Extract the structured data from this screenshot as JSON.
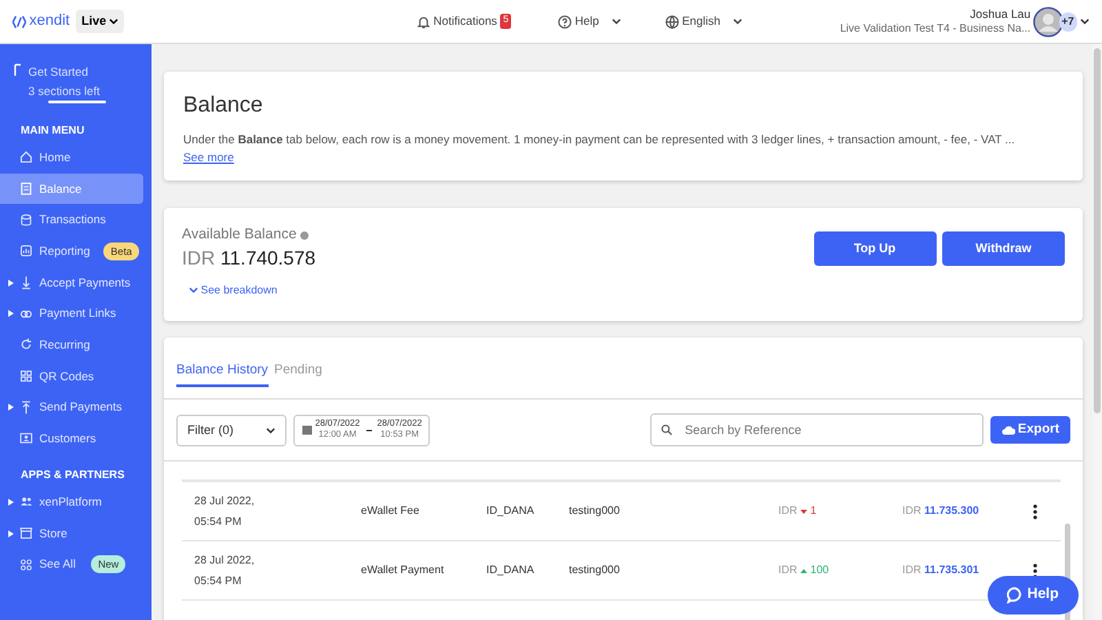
{
  "topbar": {
    "logo": "xendit",
    "mode": "Live",
    "notifications": {
      "label": "Notifications",
      "count": "5"
    },
    "help": "Help",
    "language": "English",
    "user": {
      "name": "Joshua Lau",
      "business": "Live Validation Test T4 - Business Na...",
      "extra": "+7"
    }
  },
  "sidebar": {
    "get_started": {
      "title": "Get Started",
      "subtitle": "3 sections left"
    },
    "sections": [
      {
        "heading": "MAIN MENU",
        "items": [
          {
            "label": "Home",
            "expandable": false,
            "selected": false
          },
          {
            "label": "Balance",
            "expandable": false,
            "selected": true
          },
          {
            "label": "Transactions",
            "expandable": false,
            "selected": false
          },
          {
            "label": "Reporting",
            "expandable": false,
            "selected": false,
            "badge": {
              "text": "Beta",
              "color": "#f9d67a"
            }
          },
          {
            "label": "Accept Payments",
            "expandable": true,
            "selected": false
          },
          {
            "label": "Payment Links",
            "expandable": true,
            "selected": false
          },
          {
            "label": "Recurring",
            "expandable": false,
            "selected": false
          },
          {
            "label": "QR Codes",
            "expandable": false,
            "selected": false
          },
          {
            "label": "Send Payments",
            "expandable": true,
            "selected": false
          },
          {
            "label": "Customers",
            "expandable": false,
            "selected": false
          }
        ]
      },
      {
        "heading": "APPS & PARTNERS",
        "items": [
          {
            "label": "xenPlatform",
            "expandable": true,
            "selected": false
          },
          {
            "label": "Store",
            "expandable": true,
            "selected": false
          },
          {
            "label": "See All",
            "expandable": false,
            "selected": false,
            "badge": {
              "text": "New",
              "color": "#b5eedb"
            }
          }
        ]
      }
    ]
  },
  "header_card": {
    "title": "Balance",
    "description": "Under the **Balance** tab below, each row is a money movement. 1 money-in payment can be represented with 3 ledger lines, + transaction amount, - fee, - VAT ...",
    "link": "See more"
  },
  "balance_card": {
    "label": "Available Balance",
    "currency": "IDR",
    "amount": "11.740.578",
    "breakdown": "See breakdown",
    "buttons": [
      "Top Up",
      "Withdraw"
    ]
  },
  "history": {
    "tabs": [
      {
        "label": "Balance History",
        "selected": true
      },
      {
        "label": "Pending",
        "selected": false
      }
    ],
    "filter": "Filter (0)",
    "date_range": {
      "from_date": "28/07/2022",
      "from_time": "12:00 AM",
      "to_date": "28/07/2022",
      "to_time": "10:53 PM"
    },
    "search": {
      "placeholder": "Search by Reference"
    },
    "export": "Export",
    "rows": [
      {
        "date": "28 Jul 2022,",
        "time": "05:54 PM",
        "type": "eWallet Fee",
        "channel": "ID_DANA",
        "reference": "testing000",
        "currency": "IDR",
        "kind": "debit",
        "amount": "1",
        "balance_currency": "IDR",
        "balance": "11.735.300"
      },
      {
        "date": "28 Jul 2022,",
        "time": "05:54 PM",
        "type": "eWallet Payment",
        "channel": "ID_DANA",
        "reference": "testing000",
        "currency": "IDR",
        "kind": "credit",
        "amount": "100",
        "balance_currency": "IDR",
        "balance": "11.735.301"
      }
    ]
  },
  "help_button": "Help"
}
